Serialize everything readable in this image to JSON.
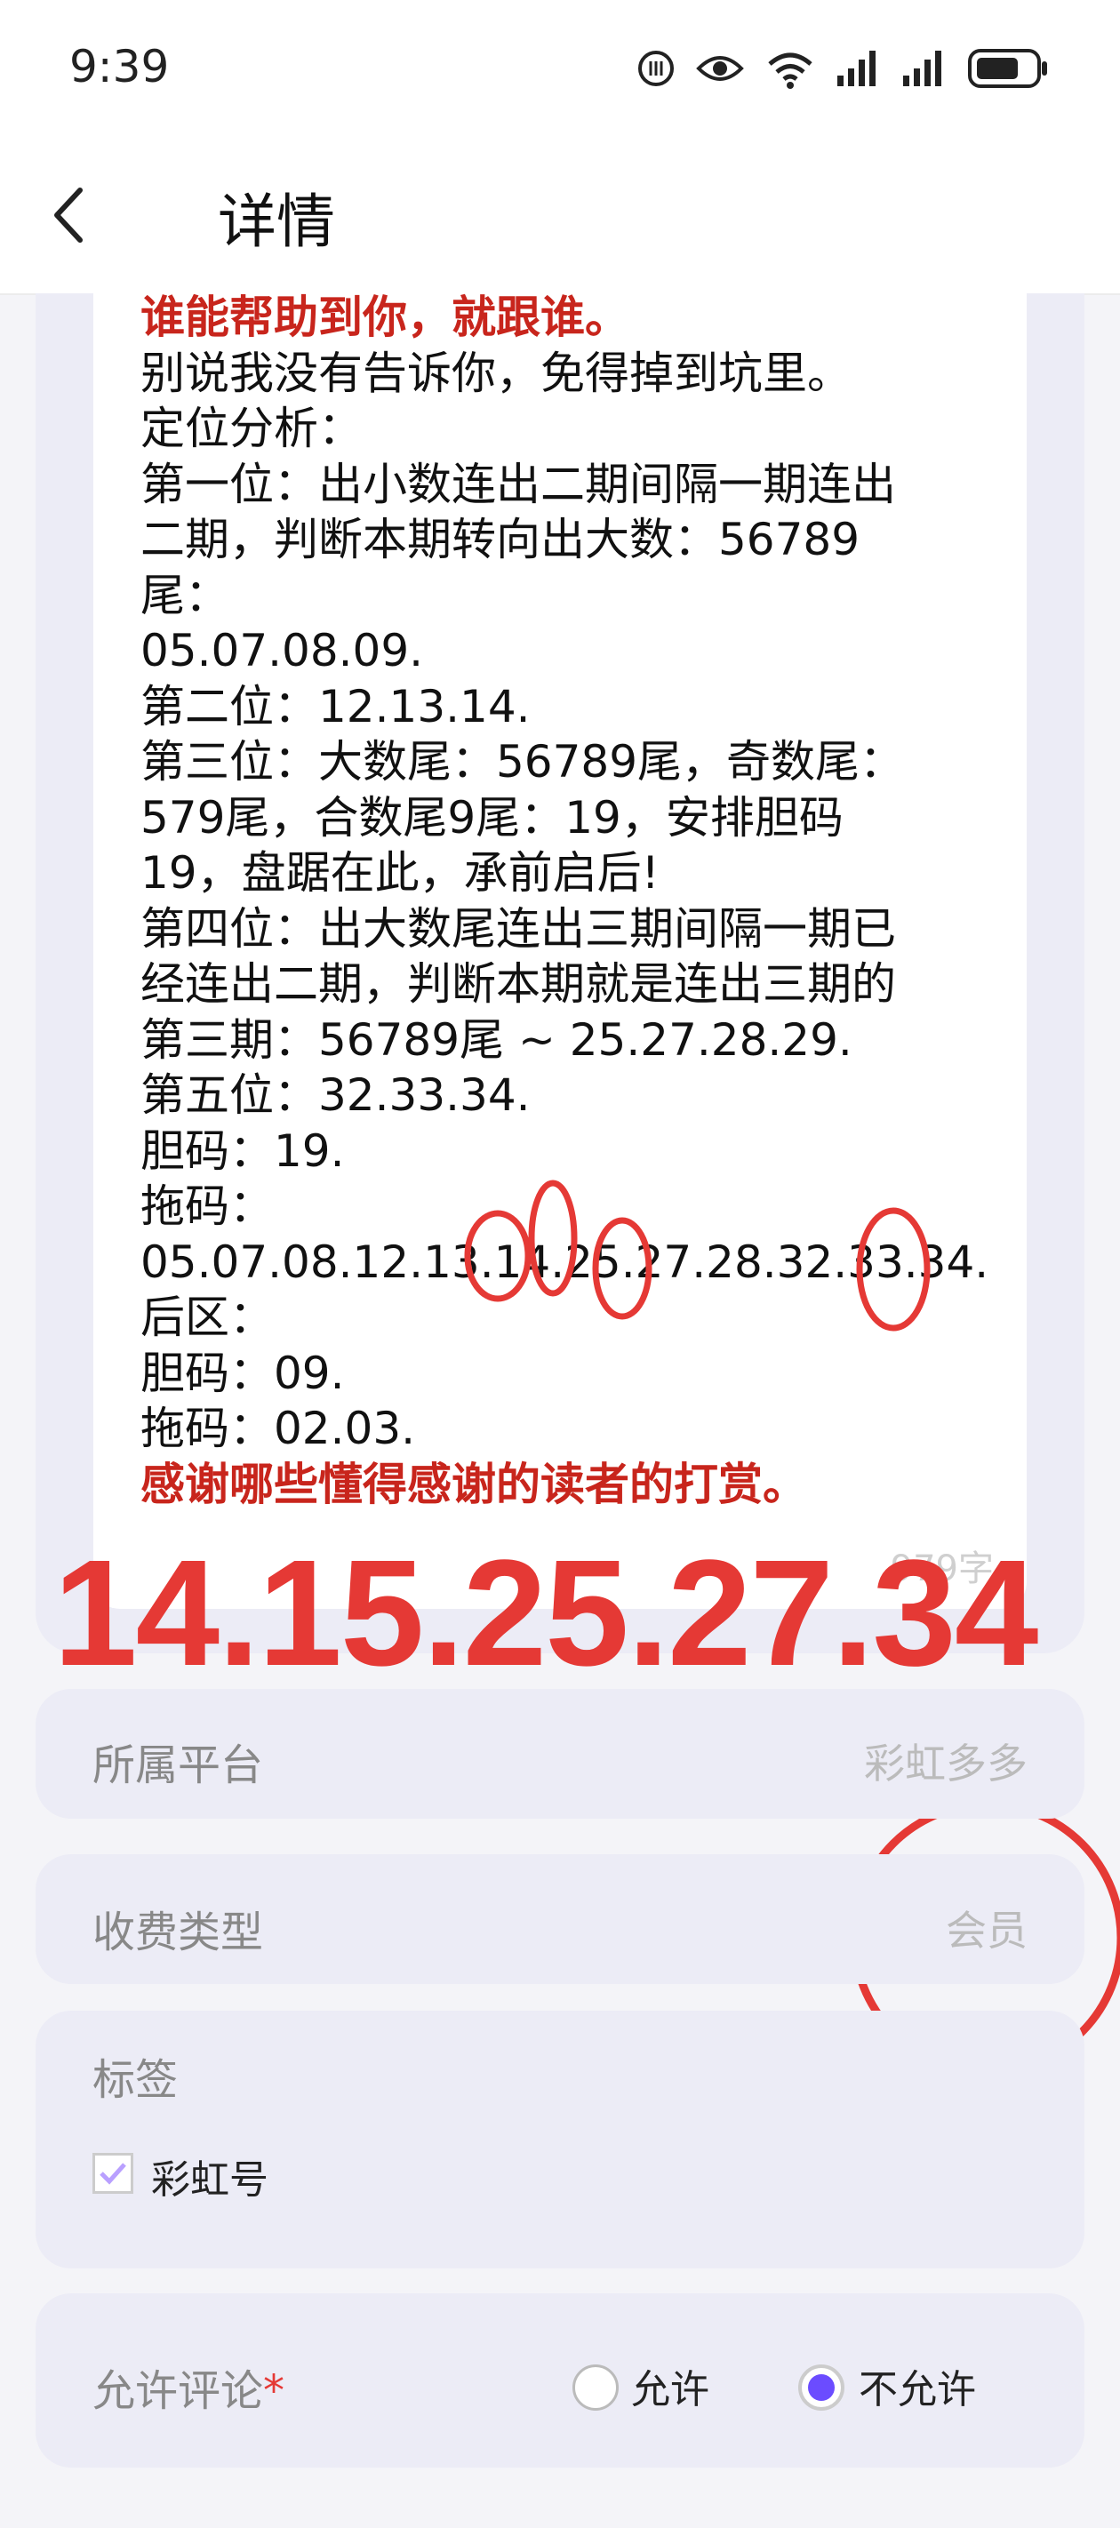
{
  "status_bar": {
    "time": "9:39"
  },
  "header": {
    "title": "详情"
  },
  "article": {
    "lines": [
      {
        "text": "谁能帮助到你，就跟谁。",
        "red": true
      },
      {
        "text": "别说我没有告诉你，免得掉到坑里。"
      },
      {
        "text": "定位分析："
      },
      {
        "text": "第一位：出小数连出二期间隔一期连出"
      },
      {
        "text": "二期，判断本期转向出大数：56789"
      },
      {
        "text": "尾："
      },
      {
        "text": "05.07.08.09."
      },
      {
        "text": "第二位：12.13.14."
      },
      {
        "text": "第三位：大数尾：56789尾，奇数尾："
      },
      {
        "text": "579尾，合数尾9尾：19，安排胆码"
      },
      {
        "text": "19，盘踞在此，承前启后!"
      },
      {
        "text": "第四位：出大数尾连出三期间隔一期已"
      },
      {
        "text": "经连出二期，判断本期就是连出三期的"
      },
      {
        "text": "第三期：56789尾 ~ 25.27.28.29."
      },
      {
        "text": "第五位：32.33.34."
      },
      {
        "text": "胆码：19."
      },
      {
        "text": "拖码："
      },
      {
        "text": "05.07.08.12.13.14.25.27.28.32.33.34."
      },
      {
        "text": "后区："
      },
      {
        "text": "胆码：09."
      },
      {
        "text": "拖码：02.03."
      },
      {
        "text": "感谢哪些懂得感谢的读者的打赏。",
        "red": true
      }
    ],
    "word_count": "979字"
  },
  "overlay_text": "14.15.25.27.34",
  "platform": {
    "label": "所属平台",
    "value": "彩虹多多"
  },
  "fee_type": {
    "label": "收费类型",
    "value": "会员"
  },
  "tags": {
    "label": "标签",
    "items": [
      {
        "label": "彩虹号",
        "checked": true
      }
    ]
  },
  "comments": {
    "label": "允许评论",
    "required_mark": "*",
    "options": [
      {
        "label": "允许",
        "selected": false
      },
      {
        "label": "不允许",
        "selected": true
      }
    ]
  },
  "colors": {
    "accent": "#6b4cff",
    "highlight_red": "#e53935",
    "article_red": "#c8251c"
  }
}
